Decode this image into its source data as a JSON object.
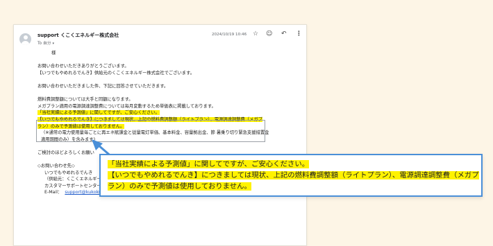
{
  "email": {
    "sender": "support くこくエネルギー株式会社",
    "recipient": "To 自分",
    "timestamp": "2024/10/19 10:46",
    "header_icons": [
      "star-icon",
      "emoji-icon",
      "reply-icon",
      "more-icon"
    ],
    "lines": [
      "様",
      "お問い合わせいただきありがとうございます。",
      "【いつでもやめれるでんき】供給元のくこくエネルギー株式会社でございます。",
      "お問い合わせいただきました件、下記に回答させていただきます。",
      "燃料費調整額については大手と同額になります。",
      "メガプラン適用の電源調達調整費については毎月変動するため単価表に掲載しております。",
      "「当社実績による予測値」に関してですが、ご安心ください。",
      "【いつでもやめれるでんき】につきましては現状、上記の燃料費調整額（ライトプラン）、電源調達調整費（メガプ",
      "ラン）のみで予測値は使用しておりません。",
      "（※通常の電力使用量毎ごとに再エネ賦課金と従量電灯単価、基本料金、容量拠出金、節 暑乗り切り緊急支援措置金",
      "適用期間のみ）を含みます)",
      "ご検討のほどよろしくお願い",
      "◇お問い合わせ先◇",
      "いつでもやめれるでんき",
      "（供給元：くこくエネルギー株式会社）",
      "カスタマーサポートセンター",
      "E-Mail：",
      "support@kukoku-energy.co.jp"
    ]
  },
  "zoom": {
    "line1": "「当社実績による予測値」に関してですが、ご安心ください。",
    "line2": "【いつでもやめれるでんき】につきましては現状、上記の燃料費調整額（ライトプラン）、電源調達調整費（メガプ",
    "line3": "ラン）のみで予測値は使用しておりません。"
  },
  "colors": {
    "highlight": "#fff200",
    "accent_blue": "#4a8fd8",
    "background": "#fdf5e6"
  }
}
